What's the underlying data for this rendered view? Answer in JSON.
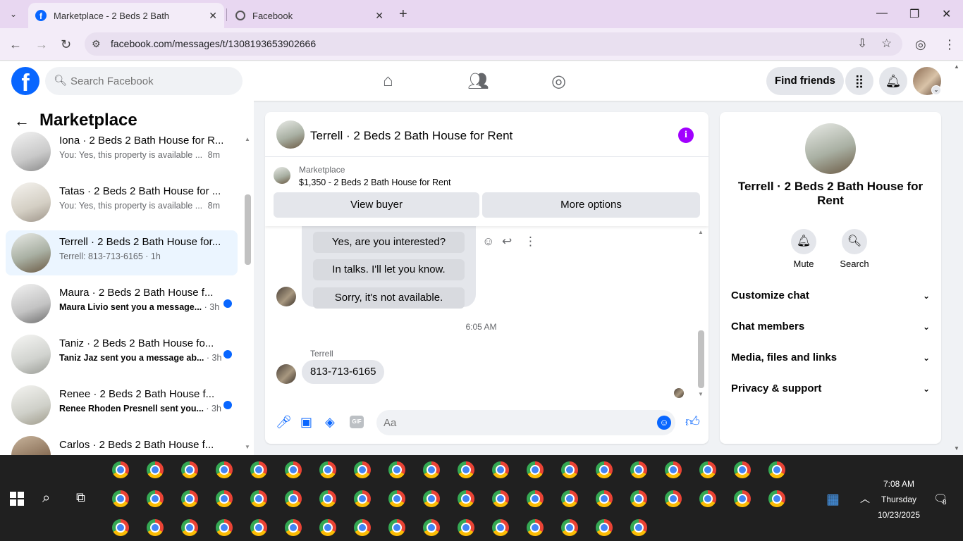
{
  "browser": {
    "tabs": [
      {
        "title": "Marketplace - 2 Beds 2 Bath House for Rent",
        "icon": "facebook-icon"
      },
      {
        "title": "Facebook",
        "icon": "facebook-icon"
      }
    ],
    "url": "facebook.com/messages/t/1308193653902666"
  },
  "fb_header": {
    "logo": "f",
    "search_placeholder": "Search Facebook",
    "find_friends": "Find friends"
  },
  "sidebar": {
    "title": "Marketplace",
    "conversations": [
      {
        "name": "Iona · 2 Beds 2 Bath House for R...",
        "preview": "You: Yes, this property is available ...",
        "time": "8m",
        "unread": false
      },
      {
        "name": "Tatas · 2 Beds 2 Bath House for ...",
        "preview": "You: Yes, this property is available ...",
        "time": "8m",
        "unread": false
      },
      {
        "name": "Terrell · 2 Beds 2 Bath House for...",
        "preview": "Terrell: 813-713-6165 · 1h",
        "time": "",
        "unread": false
      },
      {
        "name": "Maura · 2 Beds 2 Bath House f...",
        "preview": "Maura Livio sent you a message...",
        "time": "· 3h",
        "unread": true
      },
      {
        "name": "Taniz · 2 Beds 2 Bath House fo...",
        "preview": "Taniz Jaz sent you a message ab...",
        "time": "· 3h",
        "unread": true
      },
      {
        "name": "Renee · 2 Beds 2 Bath House f...",
        "preview": "Renee Rhoden Presnell sent you...",
        "time": "· 3h",
        "unread": true
      },
      {
        "name": "Carlos · 2 Beds 2 Bath House f...",
        "preview": "",
        "time": "",
        "unread": true
      }
    ]
  },
  "chat": {
    "title": "Terrell · 2 Beds 2 Bath House for Rent",
    "listing_label": "Marketplace",
    "listing_price_title": "$1,350 - 2 Beds 2 Bath House for Rent",
    "view_buyer": "View buyer",
    "more_options": "More options",
    "quick_replies": [
      "Yes, are you interested?",
      "In talks. I'll let you know.",
      "Sorry, it's not available."
    ],
    "timestamp": "6:05 AM",
    "sender": "Terrell",
    "message": "813-713-6165",
    "input_placeholder": "Aa"
  },
  "info_panel": {
    "name": "Terrell · 2 Beds 2 Bath House for Rent",
    "actions": [
      {
        "label": "Mute",
        "icon": "bell-icon"
      },
      {
        "label": "Search",
        "icon": "search-icon"
      }
    ],
    "sections": [
      "Customize chat",
      "Chat members",
      "Media, files and links",
      "Privacy & support"
    ]
  },
  "taskbar": {
    "time": "7:08 AM",
    "day": "Thursday",
    "date": "10/23/2025",
    "notification_count": "8"
  },
  "colors": {
    "fb_blue": "#0866ff",
    "selected_conv": "#ebf5ff",
    "info_purple": "#a100ff",
    "chrome_tab_bar": "#e8d7f1"
  }
}
